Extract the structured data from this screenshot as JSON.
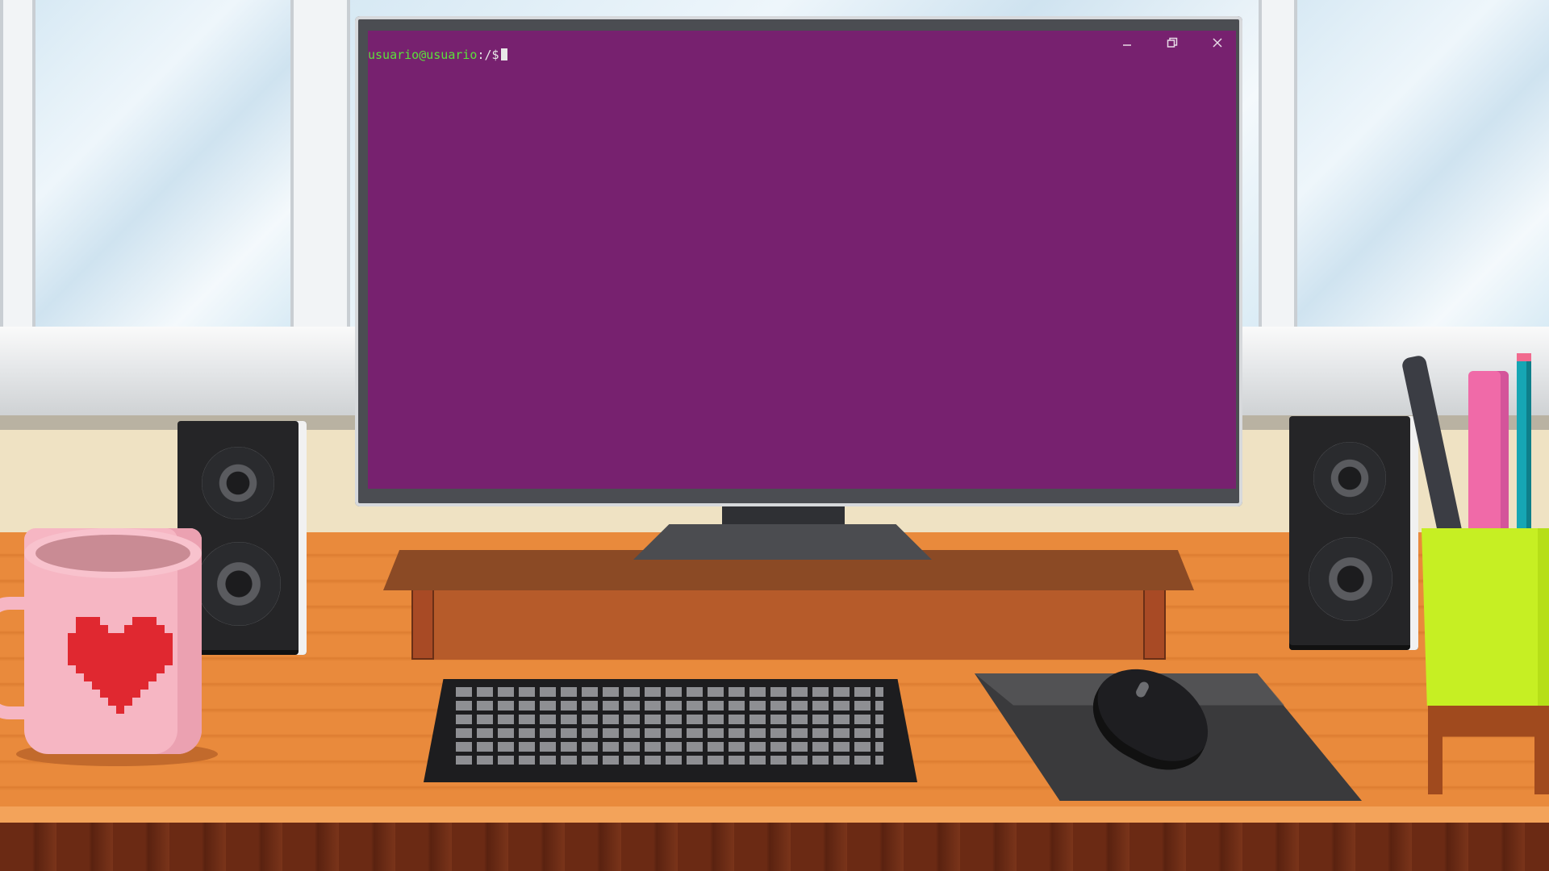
{
  "terminal": {
    "prompt_user": "usuario@usuario",
    "prompt_path": ":/$",
    "controls": {
      "minimize": "–",
      "restore": "❐",
      "close": "✕"
    }
  },
  "colors": {
    "terminal_background": "#77216f",
    "prompt_user": "#5be13b",
    "desk": "#e98a3c",
    "mug": "#f6b6c3",
    "heart": "#e02830",
    "pen_cup": "#c6ef23"
  },
  "icons": {
    "minimize": "minimize-icon",
    "restore": "restore-icon",
    "close": "close-icon",
    "heart": "heart-icon"
  }
}
